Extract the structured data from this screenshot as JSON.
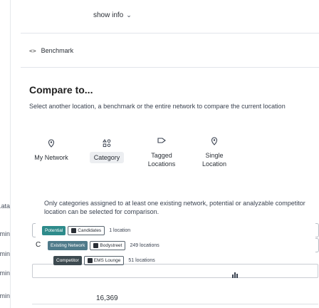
{
  "background": {
    "labels": [
      "ata...",
      "min",
      "min",
      "min",
      "min"
    ]
  },
  "header": {
    "show_info": "show info"
  },
  "benchmark": {
    "label": "Benchmark"
  },
  "compare": {
    "title": "Compare to...",
    "description": "Select another location, a benchmark or the entire network to compare the current location"
  },
  "options": [
    {
      "label": "My Network",
      "icon": "pin-icon"
    },
    {
      "label": "Category",
      "icon": "category-icon"
    },
    {
      "label": "Tagged Locations",
      "icon": "tag-icon"
    },
    {
      "label": "Single Location",
      "icon": "pin-icon"
    }
  ],
  "note": "Only categories assigned to at least one existing network, potential or analyzable competitor location can be selected for comparison.",
  "rows": [
    {
      "badge": "Potential",
      "pill": "Candidates",
      "count": "1 location"
    },
    {
      "badge": "Existing Network",
      "pill": "Bodystreet",
      "count": "249 locations"
    },
    {
      "badge": "Competitor",
      "pill": "EMS Lounge",
      "count": "51 locations"
    }
  ],
  "side_letter": "C",
  "total": "16,369",
  "colors": {
    "potential": "#2e8b8b",
    "existing": "#4f7a8a",
    "competitor": "#3d4a50"
  }
}
